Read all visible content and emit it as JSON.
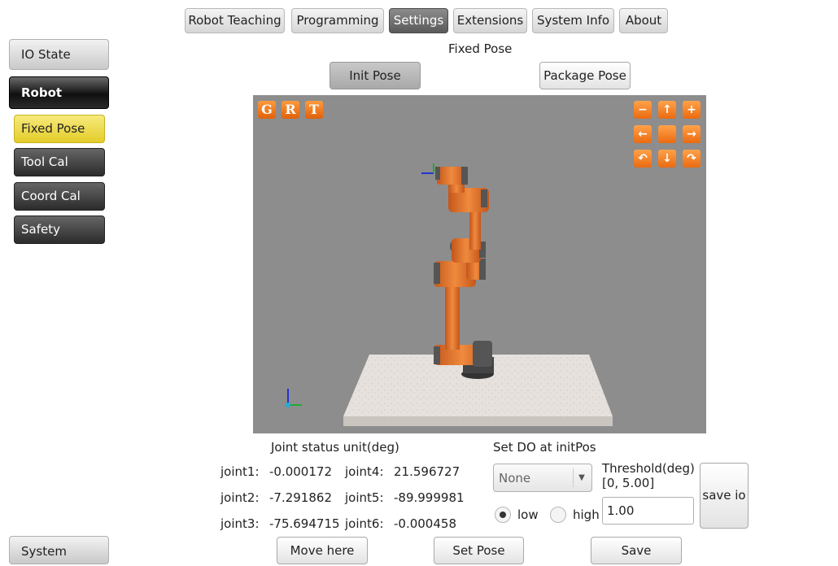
{
  "tabs": [
    "Robot Teaching",
    "Programming",
    "Settings",
    "Extensions",
    "System Info",
    "About"
  ],
  "active_tab": "Settings",
  "sidebar": {
    "io_state": "IO State",
    "robot": "Robot",
    "items": [
      "Fixed Pose",
      "Tool Cal",
      "Coord Cal",
      "Safety"
    ],
    "system": "System"
  },
  "panel": {
    "title": "Fixed Pose",
    "init_pose": "Init Pose",
    "package_pose": "Package Pose"
  },
  "viewport": {
    "mode_buttons": [
      "G",
      "R",
      "T"
    ],
    "nav_icons": [
      "zoom-out-icon",
      "arrow-up-icon",
      "zoom-in-icon",
      "arrow-left-icon",
      "center-icon",
      "arrow-right-icon",
      "rotate-left-icon",
      "arrow-down-icon",
      "rotate-right-icon"
    ]
  },
  "joints": {
    "title": "Joint status unit(deg)",
    "items": [
      {
        "label": "joint1:",
        "value": "-0.000172"
      },
      {
        "label": "joint2:",
        "value": "-7.291862"
      },
      {
        "label": "joint3:",
        "value": "-75.694715"
      },
      {
        "label": "joint4:",
        "value": "21.596727"
      },
      {
        "label": "joint5:",
        "value": "-89.999981"
      },
      {
        "label": "joint6:",
        "value": "-0.000458"
      }
    ]
  },
  "do": {
    "title": "Set DO at initPos",
    "select_value": "None",
    "threshold_label": "Threshold(deg)",
    "threshold_range": "[0, 5.00]",
    "threshold_value": "1.00",
    "low": "low",
    "high": "high",
    "selected": "low",
    "save_io": "save io"
  },
  "actions": {
    "move_here": "Move here",
    "set_pose": "Set Pose",
    "save": "Save"
  },
  "colors": {
    "active_tab": "#6a6a6a",
    "selected_item": "#e9d43a",
    "viewport_bg": "#8d8d8d",
    "robot_orange": "#e67a2e",
    "nav_orange": "#f07a1c"
  }
}
